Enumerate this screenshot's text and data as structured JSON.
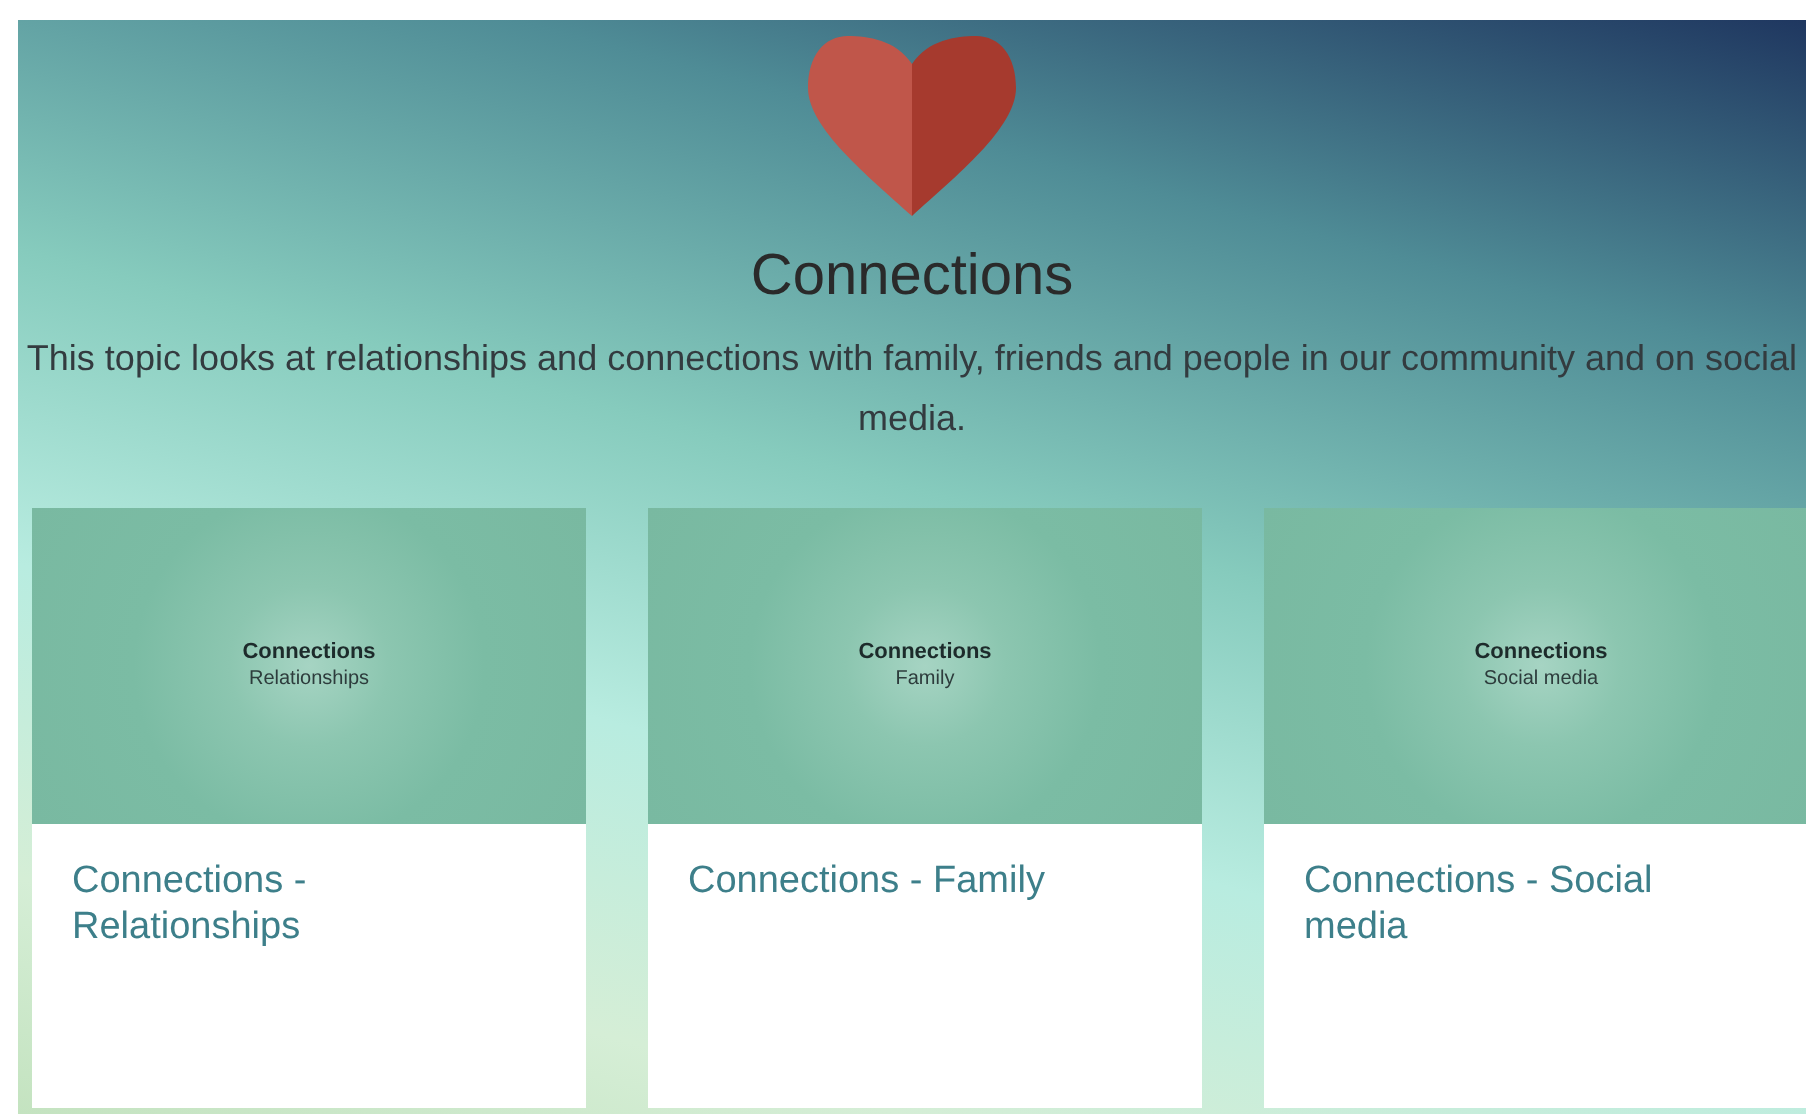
{
  "header": {
    "title": "Connections",
    "description": "This topic looks at relationships and connections with family, friends and people in our community and on social media."
  },
  "cards": [
    {
      "thumbnail_title": "Connections",
      "thumbnail_subtitle": "Relationships",
      "title": "Connections - Relationships"
    },
    {
      "thumbnail_title": "Connections",
      "thumbnail_subtitle": "Family",
      "title": "Connections - Family"
    },
    {
      "thumbnail_title": "Connections",
      "thumbnail_subtitle": "Social media",
      "title": "Connections - Social media"
    }
  ]
}
